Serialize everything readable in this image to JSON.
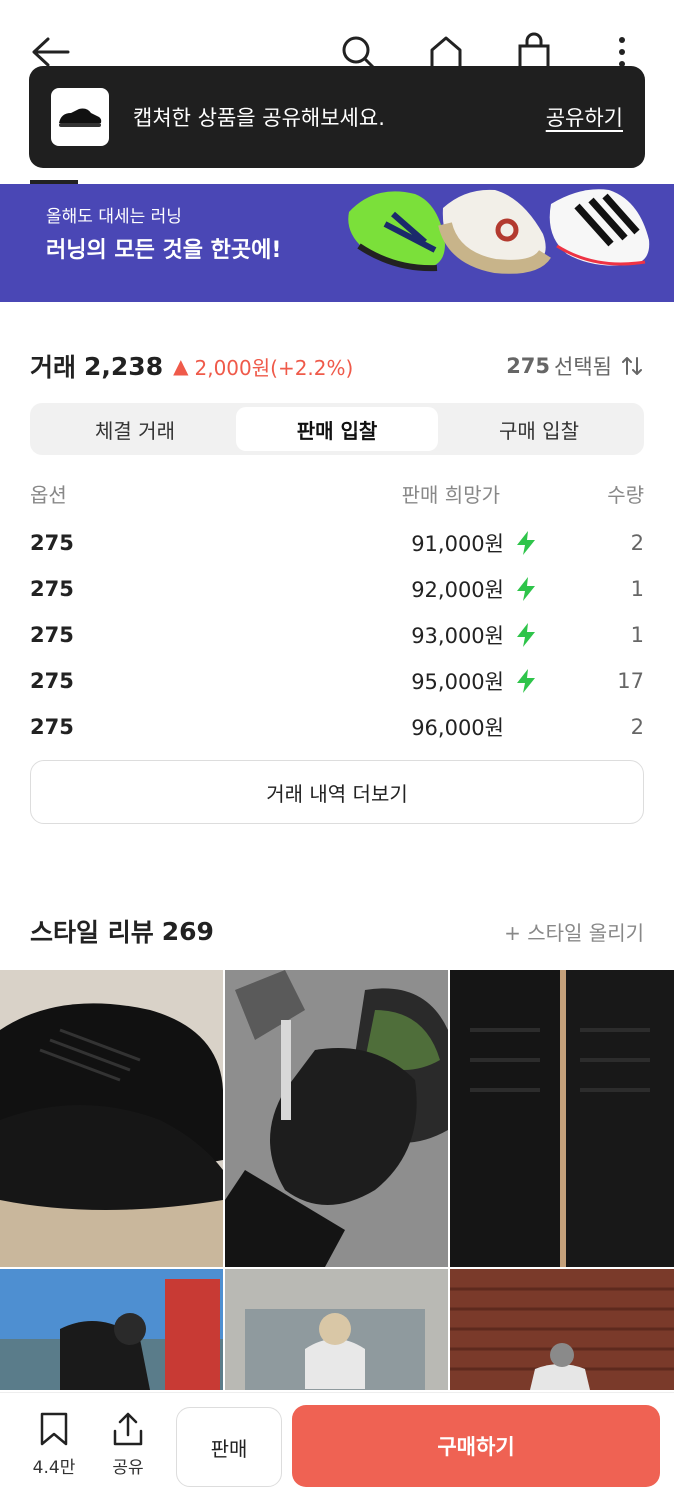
{
  "header": {
    "icons": [
      "back-arrow-icon",
      "search-icon",
      "home-icon",
      "shopping-bag-icon",
      "more-vertical-icon"
    ]
  },
  "toast": {
    "message": "캡쳐한 상품을 공유해보세요.",
    "action": "공유하기"
  },
  "banner": {
    "subtitle": "올해도 대세는 러닝",
    "title": "러닝의 모든 것을 한곳에!",
    "background": "#4a47b5"
  },
  "trade": {
    "label": "거래",
    "count": "2,238",
    "change": "2,000원(+2.2%)",
    "change_color": "#ef5a4a",
    "size": "275",
    "size_suffix": "선택됨"
  },
  "tabs": [
    {
      "label": "체결 거래"
    },
    {
      "label": "판매 입찰"
    },
    {
      "label": "구매 입찰"
    }
  ],
  "table": {
    "headers": {
      "option": "옵션",
      "price": "판매 희망가",
      "qty": "수량"
    },
    "rows": [
      {
        "option": "275",
        "price": "91,000원",
        "fast": true,
        "qty": "2"
      },
      {
        "option": "275",
        "price": "92,000원",
        "fast": true,
        "qty": "1"
      },
      {
        "option": "275",
        "price": "93,000원",
        "fast": true,
        "qty": "1"
      },
      {
        "option": "275",
        "price": "95,000원",
        "fast": true,
        "qty": "17"
      },
      {
        "option": "275",
        "price": "96,000원",
        "fast": false,
        "qty": "2"
      }
    ]
  },
  "more_button": "거래 내역 더보기",
  "style": {
    "title": "스타일 리뷰",
    "count": "269",
    "upload": "+ 스타일 올리기"
  },
  "bottom": {
    "bookmark_count": "4.4만",
    "share": "공유",
    "sell": "판매",
    "buy": "구매하기",
    "buy_color": "#ef6253"
  }
}
